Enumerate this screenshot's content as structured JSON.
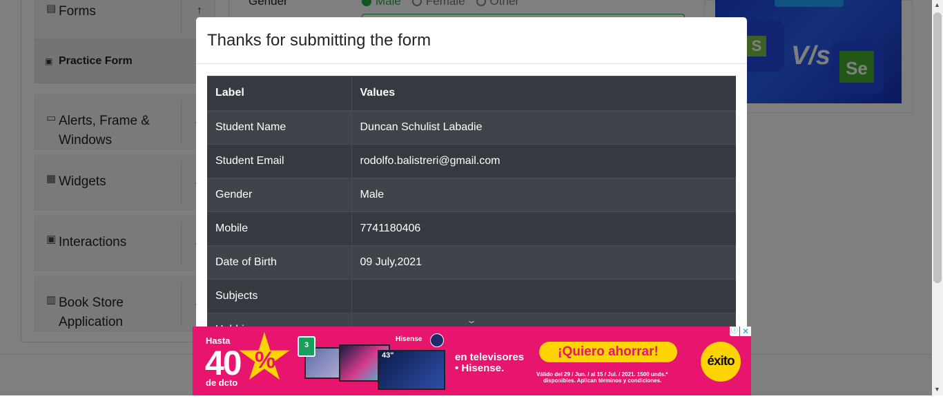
{
  "sidebar": {
    "groups": [
      {
        "label": "Forms",
        "icon": "list-icon",
        "chevron": "↑"
      },
      {
        "label": "Alerts, Frame &",
        "label2": "Windows",
        "icon": "window-icon",
        "chevron": "⌄"
      },
      {
        "label": "Widgets",
        "icon": "widgets-icon",
        "chevron": "⌄"
      },
      {
        "label": "Interactions",
        "icon": "interactions-icon",
        "chevron": "⌄"
      },
      {
        "label": "Book Store",
        "label2": "Application",
        "icon": "books-icon",
        "chevron": "⌄"
      }
    ],
    "active_item": "Practice Form"
  },
  "form": {
    "gender_label": "Gender",
    "gender_options": [
      "Male",
      "Female",
      "Other"
    ],
    "gender_selected": "Male"
  },
  "modal": {
    "title": "Thanks for submitting the form",
    "table": {
      "headers": [
        "Label",
        "Values"
      ],
      "rows": [
        {
          "label": "Student Name",
          "value": "Duncan Schulist Labadie"
        },
        {
          "label": "Student Email",
          "value": "rodolfo.balistreri@gmail.com"
        },
        {
          "label": "Gender",
          "value": "Male"
        },
        {
          "label": "Mobile",
          "value": "7741180406"
        },
        {
          "label": "Date of Birth",
          "value": "09 July,2021"
        },
        {
          "label": "Subjects",
          "value": ""
        },
        {
          "label": "Hobbies",
          "value": ""
        }
      ]
    }
  },
  "side_banner": {
    "vs_text": "V/s",
    "s_logo": "S",
    "se_logo": "Se"
  },
  "ad": {
    "hasta": "Hasta",
    "percent_number": "40",
    "percent_sign": "%",
    "dcto": "de dcto",
    "badge": "3",
    "brand": "Hisense",
    "size": "43\"",
    "line1": "en televisores",
    "line2": "• Hisense.",
    "cta": "¡Quiero ahorrar!",
    "fine1": "Válido del 29 / Jun. / al 15 / Jul. / 2021. 1500 unds.*",
    "fine2": "disponibles. Aplican términos y condiciones.",
    "store": "éxito",
    "info": "ⓘ",
    "close": "✕"
  },
  "colors": {
    "table_bg": "#343a40",
    "accent_green": "#28a745",
    "ad_pink": "#e8156e",
    "ad_yellow": "#ffd400"
  }
}
